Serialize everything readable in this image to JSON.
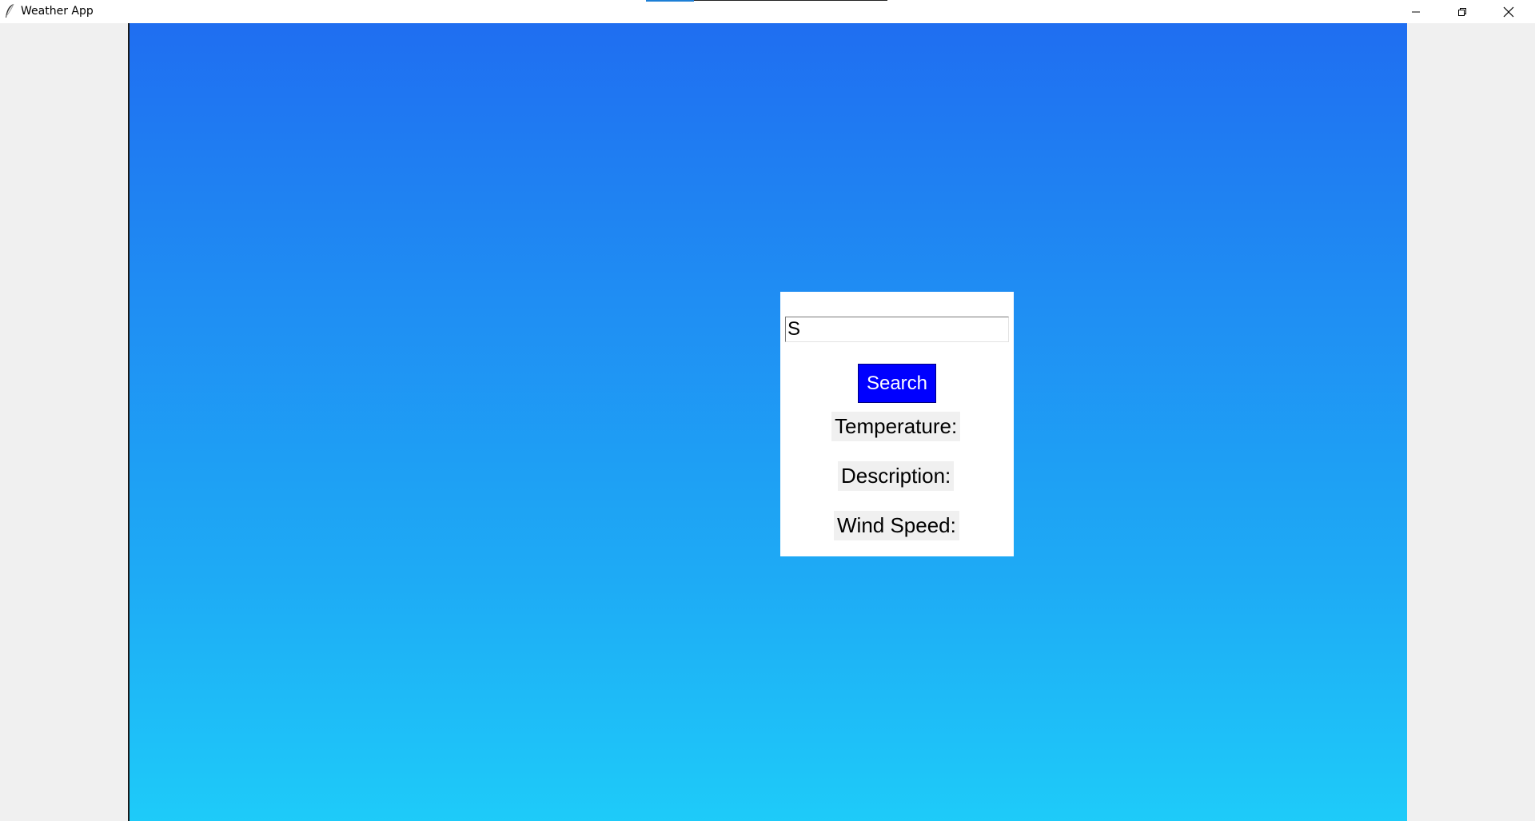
{
  "window": {
    "title": "Weather App",
    "app_icon": "tk-feather-icon",
    "controls": {
      "minimize_icon": "minimize-icon",
      "maximize_icon": "restore-icon",
      "close_icon": "close-icon"
    }
  },
  "theme": {
    "gradient_top": "#1f6ef1",
    "gradient_bottom": "#1ecbf9",
    "search_button_bg": "#0000ff",
    "search_button_text": "#ffffff",
    "panel_bg": "#ffffff",
    "label_bg": "#f0f0f0"
  },
  "search": {
    "input_value": "S",
    "button_label": "Search"
  },
  "results": {
    "temperature_label": "Temperature:",
    "description_label": "Description:",
    "wind_speed_label": "Wind Speed:"
  }
}
